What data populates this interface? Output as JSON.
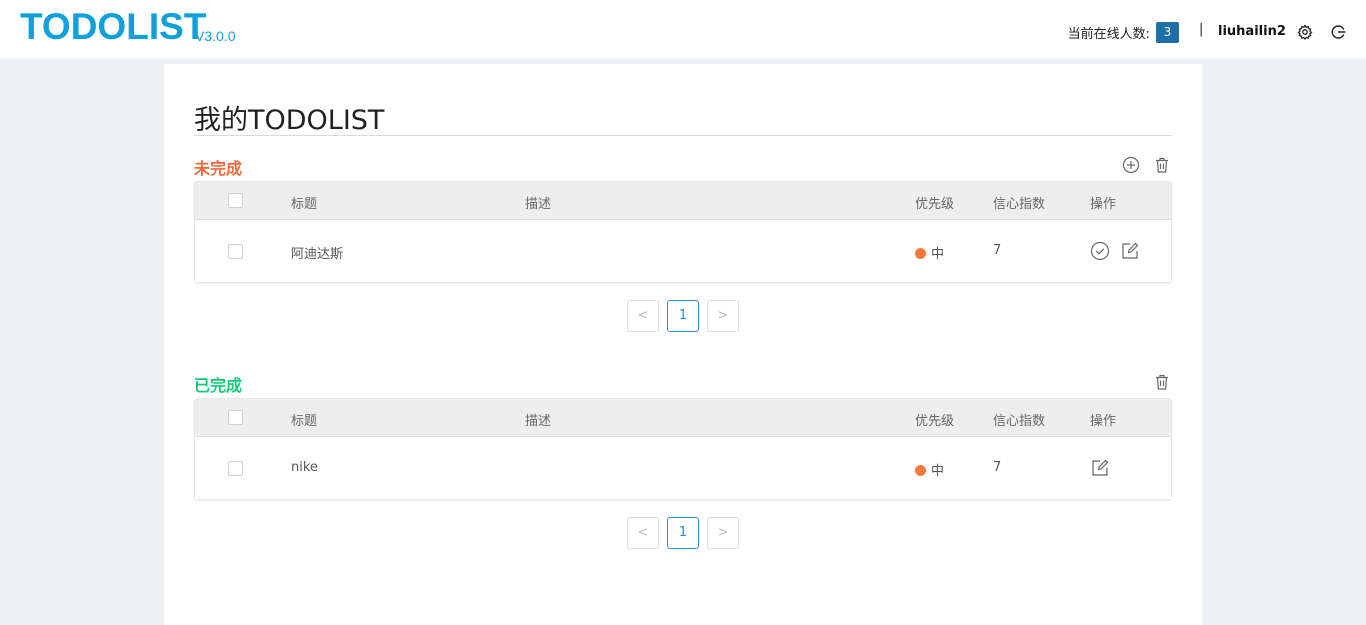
{
  "header": {
    "logo": "TODOLIST",
    "version": "V3.0.0",
    "online_label": "当前在线人数:",
    "online_count": "3",
    "divider": "|",
    "username": "liuhailin2",
    "icons": [
      "gear-icon",
      "logout-icon"
    ]
  },
  "page": {
    "title": "我的TODOLIST"
  },
  "pending": {
    "title": "未完成",
    "columns": [
      "标题",
      "描述",
      "优先级",
      "信心指数",
      "操作"
    ],
    "rows": [
      {
        "title": "阿迪达斯",
        "description": "",
        "priority": "中",
        "priority_color": "#f4793b",
        "confidence": "7"
      }
    ],
    "pager": {
      "prev": "<",
      "page": "1",
      "next": ">"
    }
  },
  "done": {
    "title": "已完成",
    "columns": [
      "标题",
      "描述",
      "优先级",
      "信心指数",
      "操作"
    ],
    "rows": [
      {
        "title": "nike",
        "description": "",
        "priority": "中",
        "priority_color": "#f4793b",
        "confidence": "7"
      }
    ],
    "pager": {
      "prev": "<",
      "page": "1",
      "next": ">"
    }
  },
  "colors": {
    "brand": "#10a1db",
    "pending_title": "#f26a3c",
    "done_title": "#14c977",
    "badge": "#1d6fa5"
  }
}
